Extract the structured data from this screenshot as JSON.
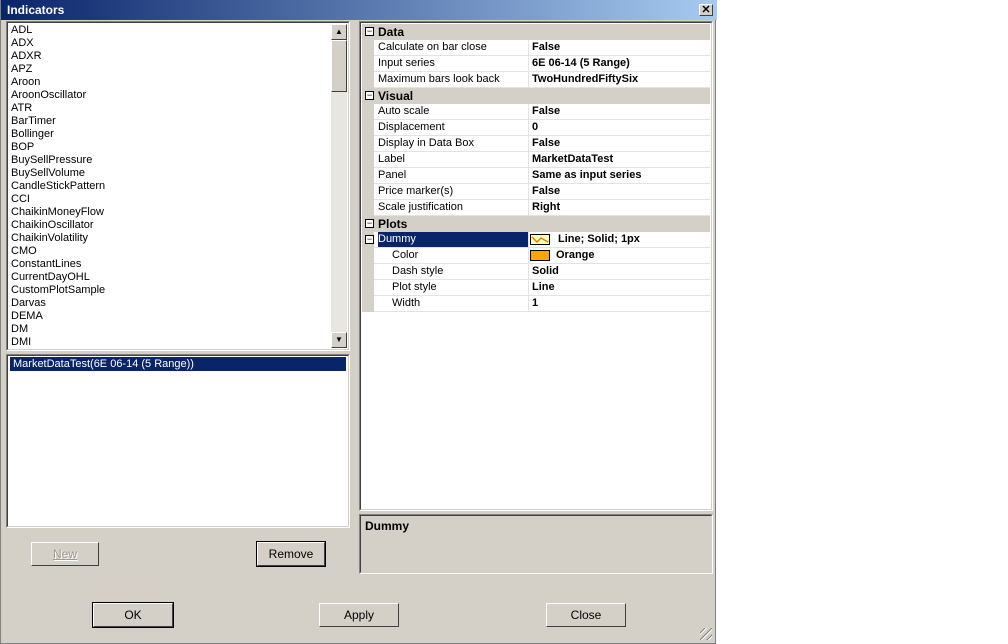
{
  "window": {
    "title": "Indicators",
    "close_glyph": "✕"
  },
  "indicator_list": [
    "ADL",
    "ADX",
    "ADXR",
    "APZ",
    "Aroon",
    "AroonOscillator",
    "ATR",
    "BarTimer",
    "Bollinger",
    "BOP",
    "BuySellPressure",
    "BuySellVolume",
    "CandleStickPattern",
    "CCI",
    "ChaikinMoneyFlow",
    "ChaikinOscillator",
    "ChaikinVolatility",
    "CMO",
    "ConstantLines",
    "CurrentDayOHL",
    "CustomPlotSample",
    "Darvas",
    "DEMA",
    "DM",
    "DMI"
  ],
  "applied": {
    "selected": "MarketDataTest(6E 06-14 (5 Range))"
  },
  "buttons": {
    "new": "New",
    "remove": "Remove",
    "ok": "OK",
    "apply": "Apply",
    "close": "Close"
  },
  "grid": {
    "data_category": "Data",
    "calc_name": "Calculate on bar close",
    "calc_value": "False",
    "input_name": "Input series",
    "input_value": "6E 06-14 (5 Range)",
    "maxbars_name": "Maximum bars look back",
    "maxbars_value": "TwoHundredFiftySix",
    "visual_category": "Visual",
    "autoscale_name": "Auto scale",
    "autoscale_value": "False",
    "displacement_name": "Displacement",
    "displacement_value": "0",
    "databox_name": "Display in Data Box",
    "databox_value": "False",
    "label_name": "Label",
    "label_value": "MarketDataTest",
    "panel_name": "Panel",
    "panel_value": "Same as input series",
    "pricemarker_name": "Price marker(s)",
    "pricemarker_value": "False",
    "scalejust_name": "Scale justification",
    "scalejust_value": "Right",
    "plots_category": "Plots",
    "dummy_name": "Dummy",
    "dummy_value": "Line; Solid; 1px",
    "color_name": "Color",
    "color_value": "Orange",
    "dash_name": "Dash style",
    "dash_value": "Solid",
    "plotstyle_name": "Plot style",
    "plotstyle_value": "Line",
    "width_name": "Width",
    "width_value": "1"
  },
  "description": {
    "title": "Dummy"
  },
  "colors": {
    "plot_color": "#ffa500",
    "selection": "#0a246a"
  }
}
